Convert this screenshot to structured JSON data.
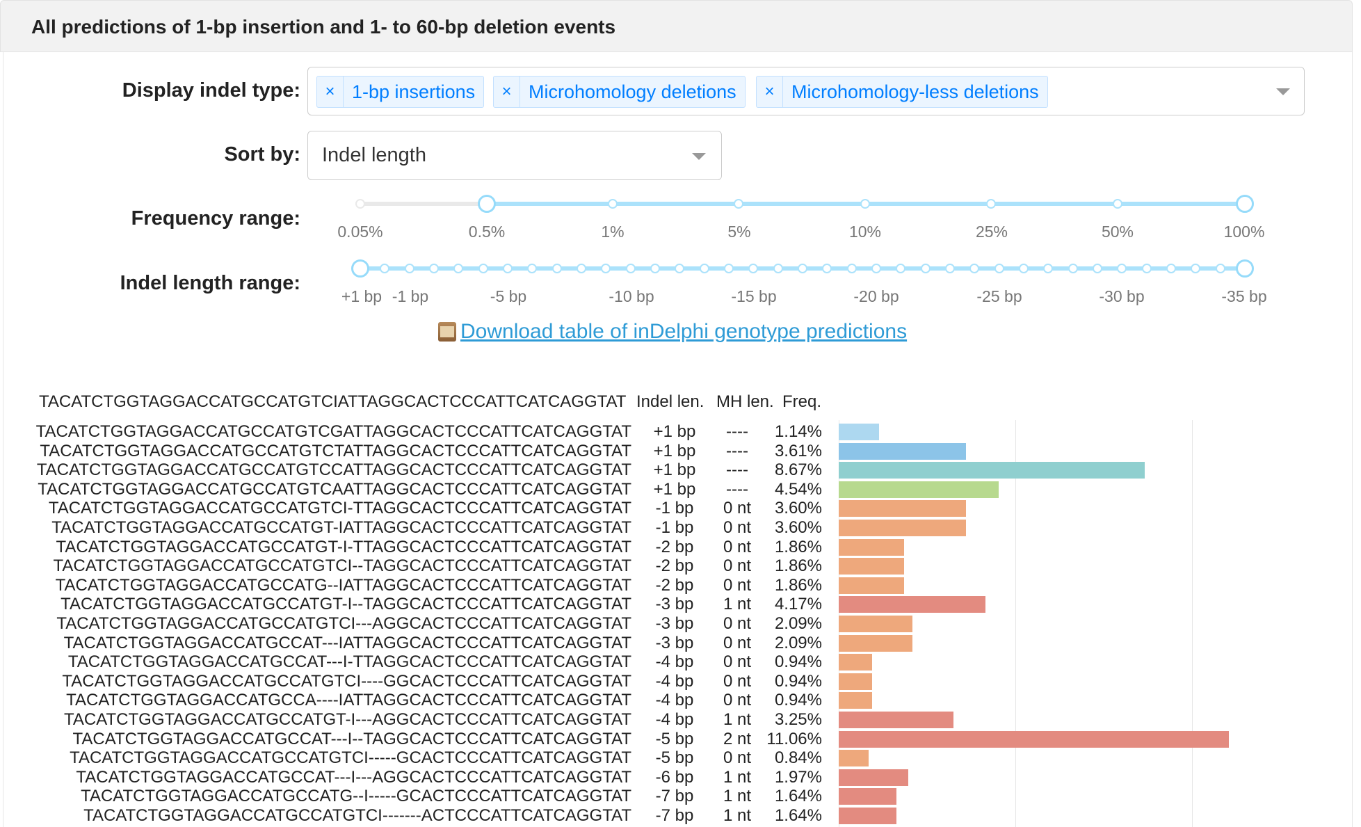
{
  "header": {
    "title": "All predictions of 1-bp insertion and 1- to 60-bp deletion events"
  },
  "form": {
    "indel_type_label": "Display indel type:",
    "indel_type_tags": [
      {
        "remove": "×",
        "label": "1-bp insertions"
      },
      {
        "remove": "×",
        "label": "Microhomology deletions"
      },
      {
        "remove": "×",
        "label": "Microhomology-less deletions"
      }
    ],
    "sort_label": "Sort by:",
    "sort_value": "Indel length",
    "freq_label": "Frequency range:",
    "freq_marks": [
      "0.05%",
      "0.5%",
      "1%",
      "5%",
      "10%",
      "25%",
      "50%",
      "100%"
    ],
    "freq_selected": [
      "0.5%",
      "100%"
    ],
    "len_label": "Indel length range:",
    "len_marks": [
      "+1 bp",
      "-1 bp",
      "-5 bp",
      "-10 bp",
      "-15 bp",
      "-20 bp",
      "-25 bp",
      "-30 bp",
      "-35 bp"
    ],
    "len_selected": [
      "+1 bp",
      "-35 bp"
    ]
  },
  "download": {
    "label": "Download table of inDelphi genotype predictions",
    "icon": "scroll-icon"
  },
  "table": {
    "reference": "TACATCTGGTAGGACCATGCCATGTCIATTAGGCACTCCCATTCATCAGGTAT",
    "col_len": "Indel len.",
    "col_mh": "MH len.",
    "col_freq": "Freq.",
    "rows": [
      {
        "seq": "TACATCTGGTAGGACCATGCCATGTCGATTAGGCACTCCCATTCATCAGGTAT",
        "len": "+1 bp",
        "mh": "----",
        "freq": "1.14%",
        "pct": 1.14,
        "color": "#add8f0"
      },
      {
        "seq": "TACATCTGGTAGGACCATGCCATGTCTATTAGGCACTCCCATTCATCAGGTAT",
        "len": "+1 bp",
        "mh": "----",
        "freq": "3.61%",
        "pct": 3.61,
        "color": "#8cc4e8"
      },
      {
        "seq": "TACATCTGGTAGGACCATGCCATGTCCATTAGGCACTCCCATTCATCAGGTAT",
        "len": "+1 bp",
        "mh": "----",
        "freq": "8.67%",
        "pct": 8.67,
        "color": "#8fcfcf"
      },
      {
        "seq": "TACATCTGGTAGGACCATGCCATGTCAATTAGGCACTCCCATTCATCAGGTAT",
        "len": "+1 bp",
        "mh": "----",
        "freq": "4.54%",
        "pct": 4.54,
        "color": "#b7d98e"
      },
      {
        "seq": "TACATCTGGTAGGACCATGCCATGTCI-TTAGGCACTCCCATTCATCAGGTAT",
        "len": "-1 bp",
        "mh": "0 nt",
        "freq": "3.60%",
        "pct": 3.6,
        "color": "#eea87c"
      },
      {
        "seq": "TACATCTGGTAGGACCATGCCATGT-IATTAGGCACTCCCATTCATCAGGTAT",
        "len": "-1 bp",
        "mh": "0 nt",
        "freq": "3.60%",
        "pct": 3.6,
        "color": "#eea87c"
      },
      {
        "seq": "TACATCTGGTAGGACCATGCCATGT-I-TTAGGCACTCCCATTCATCAGGTAT",
        "len": "-2 bp",
        "mh": "0 nt",
        "freq": "1.86%",
        "pct": 1.86,
        "color": "#eea87c"
      },
      {
        "seq": "TACATCTGGTAGGACCATGCCATGTCI--TAGGCACTCCCATTCATCAGGTAT",
        "len": "-2 bp",
        "mh": "0 nt",
        "freq": "1.86%",
        "pct": 1.86,
        "color": "#eea87c"
      },
      {
        "seq": "TACATCTGGTAGGACCATGCCATG--IATTAGGCACTCCCATTCATCAGGTAT",
        "len": "-2 bp",
        "mh": "0 nt",
        "freq": "1.86%",
        "pct": 1.86,
        "color": "#eea87c"
      },
      {
        "seq": "TACATCTGGTAGGACCATGCCATGT-I--TAGGCACTCCCATTCATCAGGTAT",
        "len": "-3 bp",
        "mh": "1 nt",
        "freq": "4.17%",
        "pct": 4.17,
        "color": "#e38b80"
      },
      {
        "seq": "TACATCTGGTAGGACCATGCCATGTCI---AGGCACTCCCATTCATCAGGTAT",
        "len": "-3 bp",
        "mh": "0 nt",
        "freq": "2.09%",
        "pct": 2.09,
        "color": "#eea87c"
      },
      {
        "seq": "TACATCTGGTAGGACCATGCCAT---IATTAGGCACTCCCATTCATCAGGTAT",
        "len": "-3 bp",
        "mh": "0 nt",
        "freq": "2.09%",
        "pct": 2.09,
        "color": "#eea87c"
      },
      {
        "seq": "TACATCTGGTAGGACCATGCCAT---I-TTAGGCACTCCCATTCATCAGGTAT",
        "len": "-4 bp",
        "mh": "0 nt",
        "freq": "0.94%",
        "pct": 0.94,
        "color": "#eea87c"
      },
      {
        "seq": "TACATCTGGTAGGACCATGCCATGTCI----GGCACTCCCATTCATCAGGTAT",
        "len": "-4 bp",
        "mh": "0 nt",
        "freq": "0.94%",
        "pct": 0.94,
        "color": "#eea87c"
      },
      {
        "seq": "TACATCTGGTAGGACCATGCCA----IATTAGGCACTCCCATTCATCAGGTAT",
        "len": "-4 bp",
        "mh": "0 nt",
        "freq": "0.94%",
        "pct": 0.94,
        "color": "#eea87c"
      },
      {
        "seq": "TACATCTGGTAGGACCATGCCATGT-I---AGGCACTCCCATTCATCAGGTAT",
        "len": "-4 bp",
        "mh": "1 nt",
        "freq": "3.25%",
        "pct": 3.25,
        "color": "#e38b80"
      },
      {
        "seq": "TACATCTGGTAGGACCATGCCAT---I--TAGGCACTCCCATTCATCAGGTAT",
        "len": "-5 bp",
        "mh": "2 nt",
        "freq": "11.06%",
        "pct": 11.06,
        "color": "#e38b80"
      },
      {
        "seq": "TACATCTGGTAGGACCATGCCATGTCI-----GCACTCCCATTCATCAGGTAT",
        "len": "-5 bp",
        "mh": "0 nt",
        "freq": "0.84%",
        "pct": 0.84,
        "color": "#eea87c"
      },
      {
        "seq": "TACATCTGGTAGGACCATGCCAT---I---AGGCACTCCCATTCATCAGGTAT",
        "len": "-6 bp",
        "mh": "1 nt",
        "freq": "1.97%",
        "pct": 1.97,
        "color": "#e38b80"
      },
      {
        "seq": "TACATCTGGTAGGACCATGCCATG--I-----GCACTCCCATTCATCAGGTAT",
        "len": "-7 bp",
        "mh": "1 nt",
        "freq": "1.64%",
        "pct": 1.64,
        "color": "#e38b80"
      },
      {
        "seq": "TACATCTGGTAGGACCATGCCATGTCI-------ACTCCCATTCATCAGGTAT",
        "len": "-7 bp",
        "mh": "1 nt",
        "freq": "1.64%",
        "pct": 1.64,
        "color": "#e38b80"
      }
    ]
  }
}
